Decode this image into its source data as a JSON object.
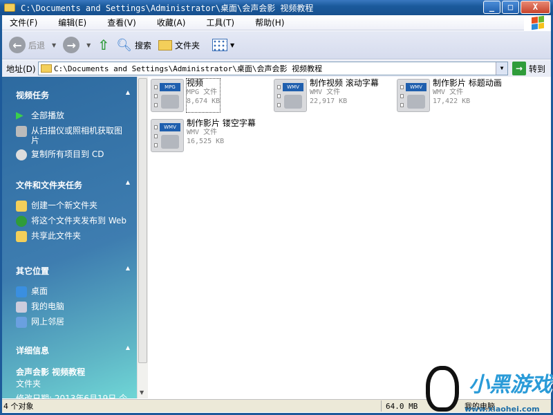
{
  "window": {
    "title": "C:\\Documents and Settings\\Administrator\\桌面\\会声会影  视频教程",
    "minimize": "_",
    "maximize": "□",
    "close": "X"
  },
  "menu": [
    "文件(F)",
    "编辑(E)",
    "查看(V)",
    "收藏(A)",
    "工具(T)",
    "帮助(H)"
  ],
  "toolbar": {
    "back": "后退",
    "search": "搜索",
    "folders": "文件夹"
  },
  "address": {
    "label": "地址(D)",
    "value": "C:\\Documents and Settings\\Administrator\\桌面\\会声会影  视频教程",
    "go": "转到"
  },
  "sidebar": {
    "video_tasks": {
      "title": "视频任务",
      "items": [
        "全部播放",
        "从扫描仪或照相机获取图片",
        "复制所有项目到 CD"
      ]
    },
    "file_tasks": {
      "title": "文件和文件夹任务",
      "items": [
        "创建一个新文件夹",
        "将这个文件夹发布到 Web",
        "共享此文件夹"
      ]
    },
    "other_places": {
      "title": "其它位置",
      "items": [
        "桌面",
        "我的电脑",
        "网上邻居"
      ]
    },
    "details": {
      "title": "详细信息",
      "name": "会声会影  视频教程",
      "type": "文件夹",
      "modified": "修改日期: 2013年6月19日 今"
    }
  },
  "files": [
    {
      "name": "视频",
      "type": "MPG 文件",
      "size": "8,674 KB",
      "tag": "MPG"
    },
    {
      "name": "制作视频  滚动字幕",
      "type": "WMV 文件",
      "size": "22,917 KB",
      "tag": "WMV"
    },
    {
      "name": "制作影片  标题动画",
      "type": "WMV 文件",
      "size": "17,422 KB",
      "tag": "WMV"
    },
    {
      "name": "制作影片  镂空字幕",
      "type": "WMV 文件",
      "size": "16,525 KB",
      "tag": "WMV"
    }
  ],
  "status": {
    "objects": "4 个对象",
    "size": "64.0 MB",
    "location": "我的电脑"
  },
  "watermark": {
    "brand": "小黑游戏",
    "url": "www.xiaohei.com"
  }
}
